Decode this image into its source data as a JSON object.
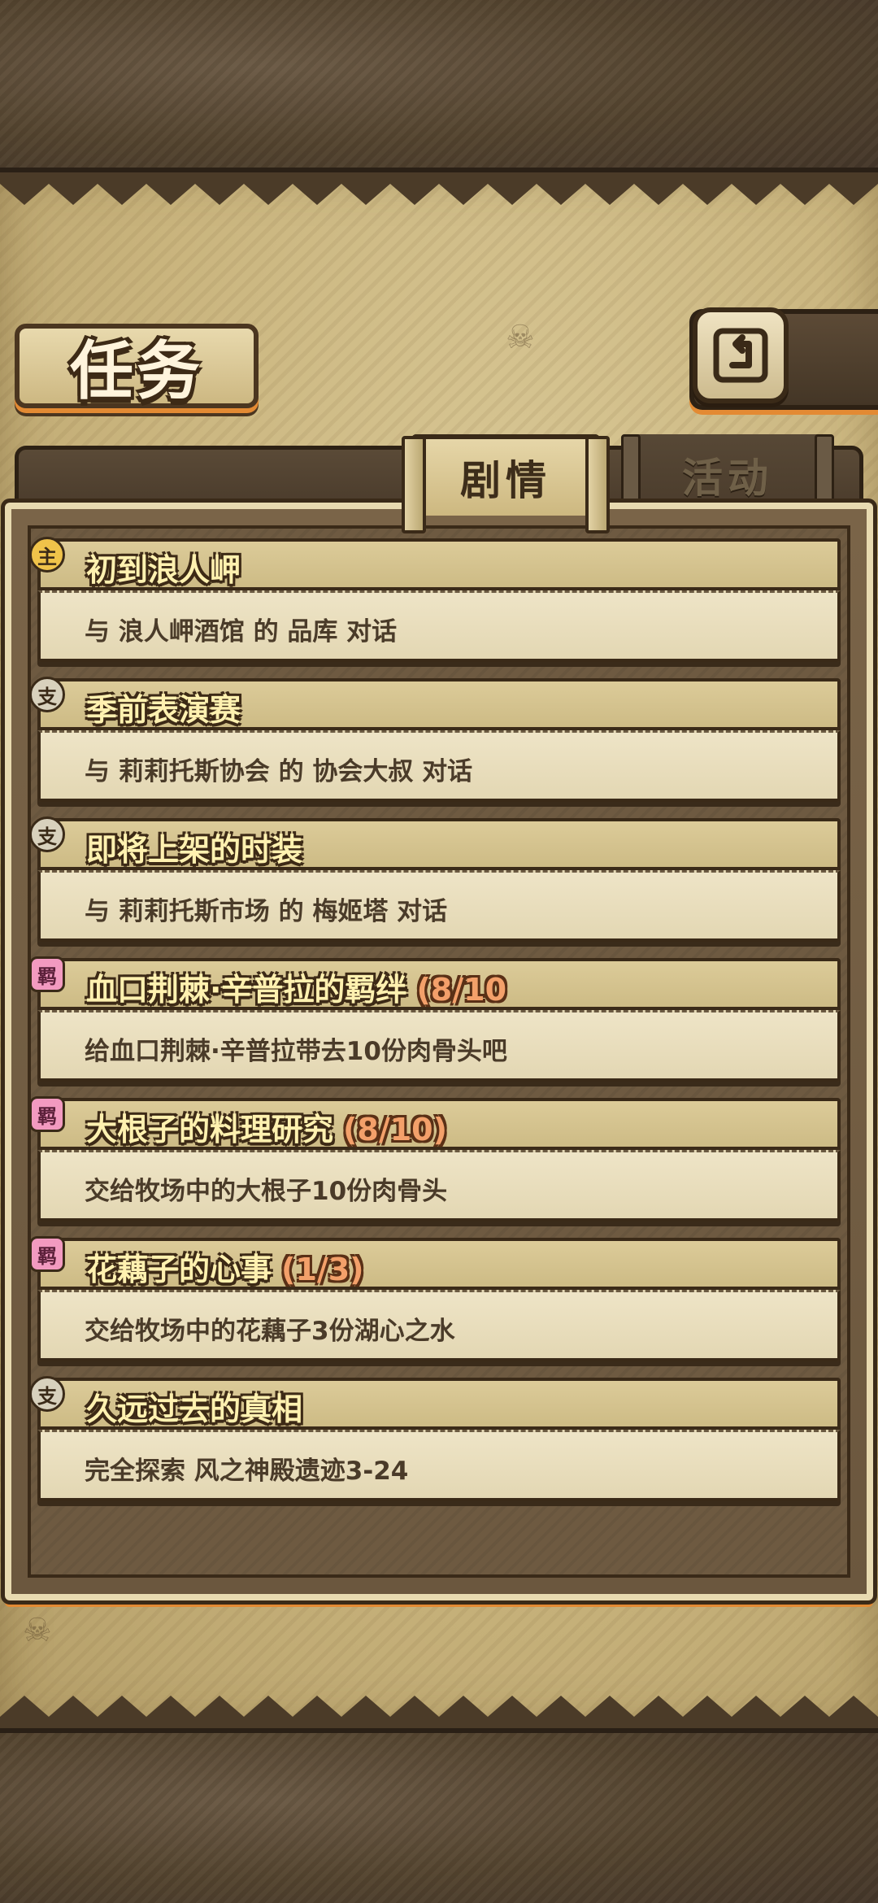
{
  "header": {
    "title": "任务",
    "back_icon": "return-arrow-icon"
  },
  "tabs": [
    {
      "label": "剧情",
      "active": true
    },
    {
      "label": "活动",
      "active": false
    }
  ],
  "quests": [
    {
      "badge": "主",
      "type": "main",
      "title": "初到浪人岬",
      "progress": "",
      "desc": "与 浪人岬酒馆 的 品库 对话"
    },
    {
      "badge": "支",
      "type": "side",
      "title": "季前表演赛",
      "progress": "",
      "desc": "与 莉莉托斯协会 的 协会大叔 对话"
    },
    {
      "badge": "支",
      "type": "side",
      "title": "即将上架的时装",
      "progress": "",
      "desc": "与 莉莉托斯市场 的 梅姬塔 对话"
    },
    {
      "badge": "羁",
      "type": "bond",
      "title": "血口荆棘·辛普拉的羁绊",
      "progress": "(8/10",
      "desc": "给血口荆棘·辛普拉带去10份肉骨头吧"
    },
    {
      "badge": "羁",
      "type": "bond",
      "title": "大根子的料理研究",
      "progress": "(8/10)",
      "desc": "交给牧场中的大根子10份肉骨头"
    },
    {
      "badge": "羁",
      "type": "bond",
      "title": "花藕子的心事",
      "progress": "(1/3)",
      "desc": "交给牧场中的花藕子3份湖心之水"
    },
    {
      "badge": "支",
      "type": "side",
      "title": "久远过去的真相",
      "progress": "",
      "desc": "完全探索 风之神殿遗迹3-24"
    }
  ],
  "colors": {
    "accent_orange": "#e38a33",
    "title_yellow": "#fff1b0",
    "progress_orange": "#f3a06a"
  }
}
